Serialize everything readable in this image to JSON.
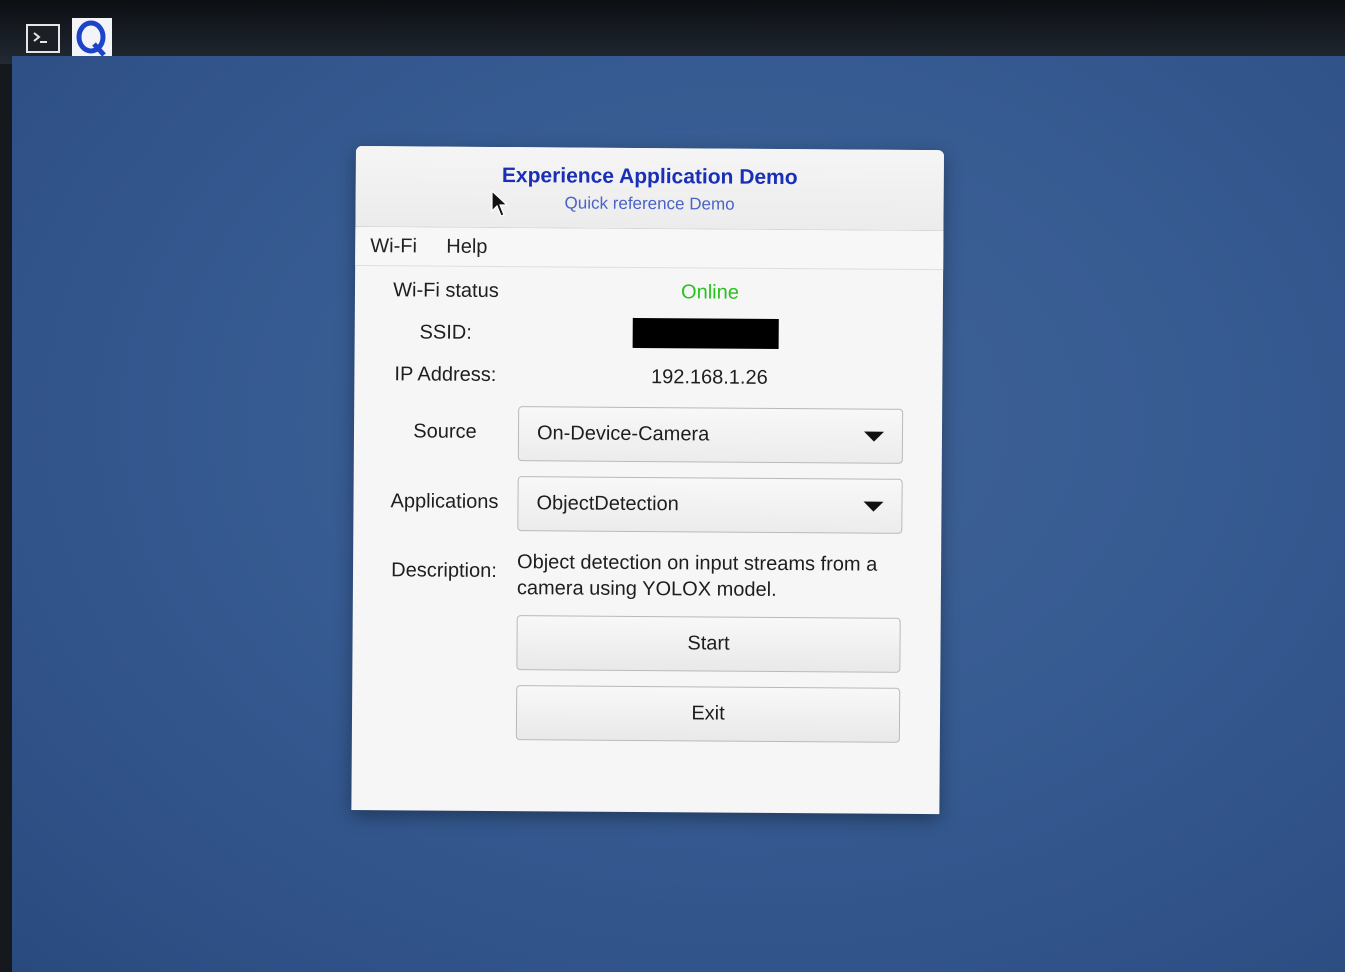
{
  "taskbar": {
    "launchers": [
      {
        "icon": "terminal-icon"
      },
      {
        "icon": "q-logo-icon"
      }
    ]
  },
  "dialog": {
    "title": "Experience Application Demo",
    "subtitle": "Quick reference Demo",
    "menu": {
      "wifi": "Wi-Fi",
      "help": "Help"
    },
    "wifi_status": {
      "label": "Wi-Fi status",
      "value": "Online",
      "value_color": "#29c21f"
    },
    "ssid": {
      "label": "SSID:"
    },
    "ip_address": {
      "label": "IP Address:",
      "value": "192.168.1.26"
    },
    "source": {
      "label": "Source",
      "selected": "On-Device-Camera"
    },
    "applications": {
      "label": "Applications",
      "selected": "ObjectDetection"
    },
    "description": {
      "label": "Description:",
      "text": "Object detection on input streams from a camera using YOLOX model."
    },
    "buttons": {
      "start": "Start",
      "exit": "Exit"
    }
  },
  "colors": {
    "desktop": "#365b92",
    "title": "#1a2fb8",
    "subtitle": "#4a63c8",
    "online": "#29c21f"
  }
}
